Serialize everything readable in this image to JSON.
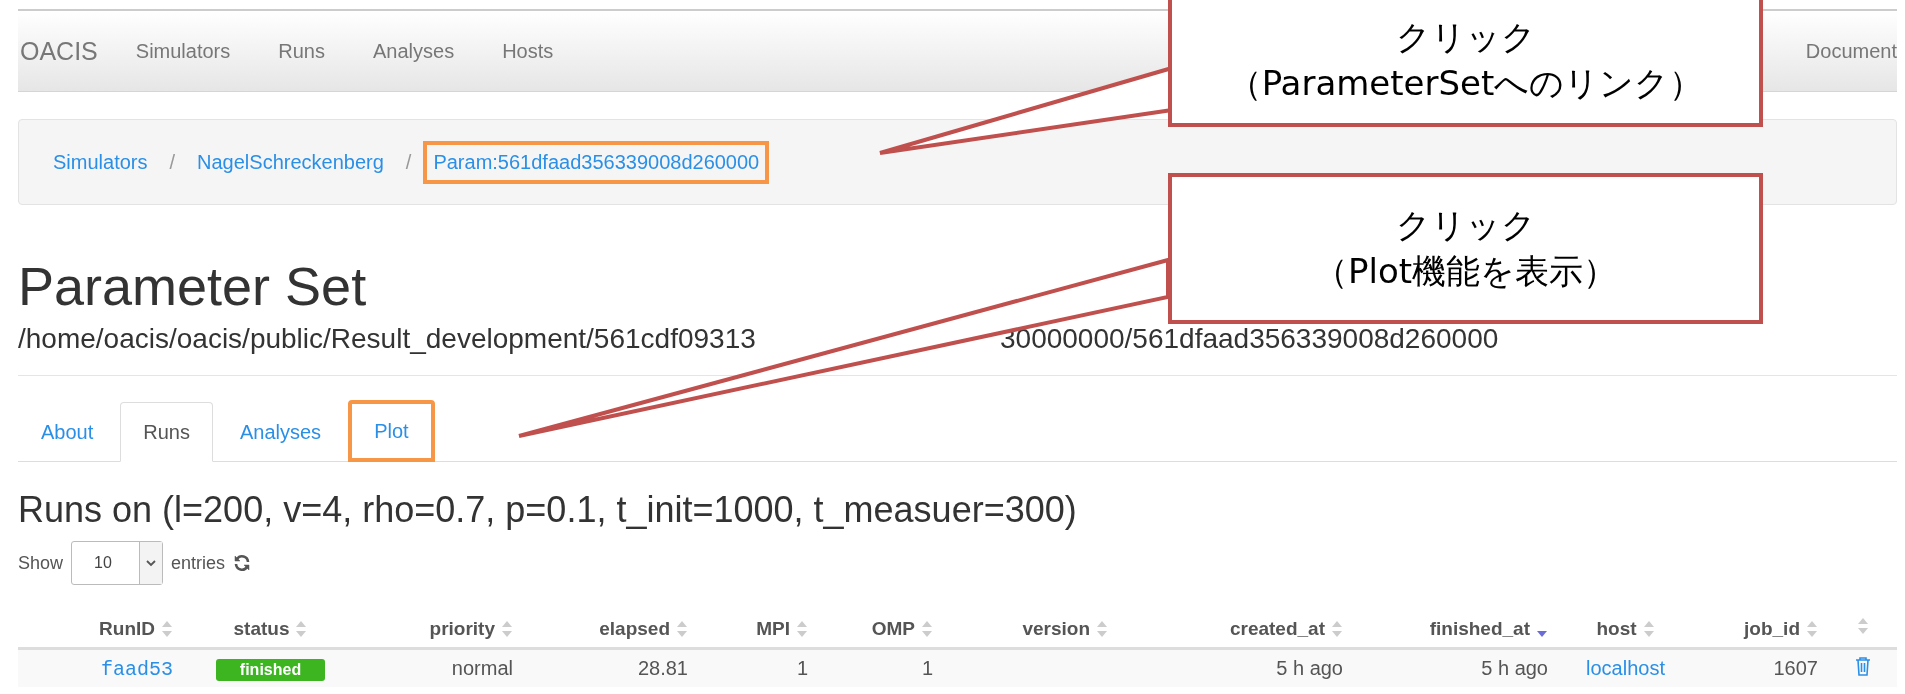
{
  "navbar": {
    "brand": "OACIS",
    "items": [
      "Simulators",
      "Runs",
      "Analyses",
      "Hosts"
    ],
    "right_items": [
      "Document"
    ]
  },
  "breadcrumb": [
    {
      "label": "Simulators",
      "highlighted": false
    },
    {
      "separator": "/",
      "label": "NagelSchreckenberg",
      "highlighted": false
    },
    {
      "separator": "/",
      "label": "Param:561dfaad356339008d260000",
      "highlighted": true
    }
  ],
  "heading": "Parameter Set",
  "path_start": "/home/oacis/oacis/public/Result_development/561cdf09313",
  "path_end": "30000000/561dfaad356339008d260000",
  "tabs": [
    {
      "label": "About",
      "selected": false,
      "highlighted": false
    },
    {
      "label": "Runs",
      "selected": true,
      "highlighted": false
    },
    {
      "label": "Analyses",
      "selected": false,
      "highlighted": false
    },
    {
      "label": "Plot",
      "selected": false,
      "highlighted": true
    }
  ],
  "runs_title": "Runs on (l=200, v=4, rho=0.7, p=0.1, t_init=1000, t_measuer=300)",
  "length_menu": {
    "label_before": "Show",
    "value": "10",
    "label_after": "entries"
  },
  "table": {
    "columns": [
      {
        "label": "RunID",
        "sorted": false
      },
      {
        "label": "status",
        "sorted": false
      },
      {
        "label": "priority",
        "sorted": false
      },
      {
        "label": "elapsed",
        "sorted": false
      },
      {
        "label": "MPI",
        "sorted": false
      },
      {
        "label": "OMP",
        "sorted": false
      },
      {
        "label": "version",
        "sorted": false
      },
      {
        "label": "created_at",
        "sorted": false
      },
      {
        "label": "finished_at",
        "sorted": true
      },
      {
        "label": "host",
        "sorted": false
      },
      {
        "label": "job_id",
        "sorted": false
      },
      {
        "sorted": false
      }
    ],
    "rows": [
      {
        "cells": [
          {
            "kind": "link",
            "text": "faad53"
          },
          {
            "kind": "badge",
            "text": "finished"
          },
          {
            "kind": "text",
            "text": "normal"
          },
          {
            "kind": "text",
            "text": "28.81"
          },
          {
            "kind": "text",
            "text": "1"
          },
          {
            "kind": "text",
            "text": "1"
          },
          {
            "kind": "empty"
          },
          {
            "kind": "text",
            "text": "5 h ago"
          },
          {
            "kind": "text",
            "text": "5 h ago"
          },
          {
            "kind": "link",
            "text": "localhost"
          },
          {
            "kind": "text",
            "text": "1607"
          },
          {
            "kind": "delete"
          }
        ]
      }
    ]
  },
  "callouts": [
    {
      "lines": [
        "クリック",
        "（ParameterSetへのリンク）"
      ]
    },
    {
      "lines": [
        "クリック",
        "（Plot機能を表示）"
      ]
    }
  ]
}
